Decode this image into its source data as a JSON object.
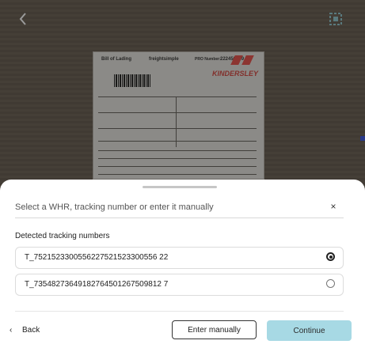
{
  "camera": {
    "back_icon": "chevron-left-icon",
    "scan_icon": "scan-frame-icon",
    "document": {
      "title": "Bill of Lading",
      "brand": "freightsimple",
      "pro_number_label": "PRO Number:",
      "pro_number": "222456789",
      "carrier": "KINDERSLEY"
    }
  },
  "sheet": {
    "search": {
      "placeholder": "Select a WHR, tracking number or enter it manually",
      "value": "",
      "clear_icon": "close-icon",
      "clear_glyph": "×"
    },
    "section_title": "Detected tracking numbers",
    "tracking_numbers": [
      {
        "number": "T_7521523300556227521523300556 22",
        "selected": true
      },
      {
        "number": "T_73548273649182764501267509812 7",
        "selected": false
      }
    ],
    "footer": {
      "back_label": "Back",
      "back_glyph": "‹",
      "enter_manually_label": "Enter manually",
      "continue_label": "Continue"
    }
  },
  "colors": {
    "continue_bg": "#a7d9e4",
    "sheet_bg": "#ffffff",
    "carrier_red": "#c8433e"
  }
}
